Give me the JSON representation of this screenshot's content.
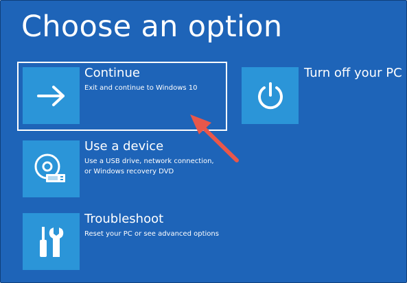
{
  "screen": {
    "title": "Choose an option",
    "colors": {
      "background": "#1e64b8",
      "tile": "#2b95d8",
      "text": "#ffffff",
      "annotation_arrow": "#e8574a"
    }
  },
  "options": [
    {
      "title": "Continue",
      "description": [
        "Exit and continue to Windows 10"
      ],
      "icon": "arrow-right-icon",
      "selected": true
    },
    {
      "title": "Use a device",
      "description": [
        "Use a USB drive, network connection,",
        "or Windows recovery DVD"
      ],
      "icon": "usb-disc-device-icon",
      "selected": false
    },
    {
      "title": "Troubleshoot",
      "description": [
        "Reset your PC or see advanced options"
      ],
      "icon": "tools-icon",
      "selected": false
    },
    {
      "title": "Turn off your PC",
      "description": [],
      "icon": "power-icon",
      "selected": false
    }
  ],
  "annotation": {
    "type": "arrow",
    "points_to": "Continue"
  }
}
